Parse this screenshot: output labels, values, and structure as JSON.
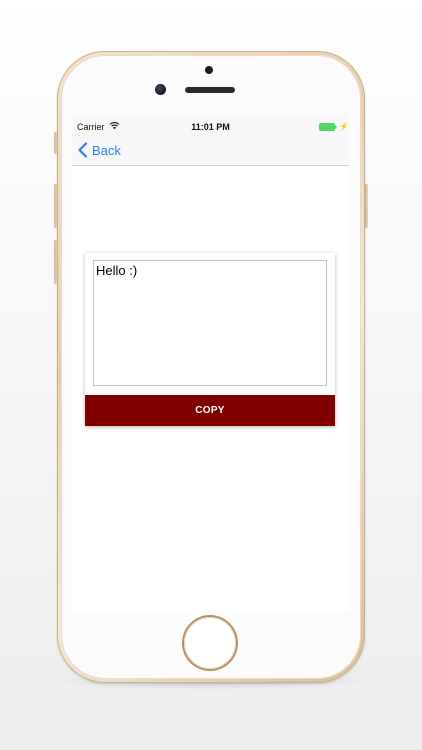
{
  "status_bar": {
    "carrier": "Carrier",
    "time": "11:01 PM",
    "wifi_icon": "wifi-icon",
    "battery_icon": "battery-charging-icon",
    "battery_color": "#4cd964"
  },
  "nav": {
    "back_label": "Back",
    "back_icon": "chevron-left-icon",
    "tint_color": "#2f7cf6"
  },
  "editor": {
    "text_value": "Hello :)",
    "copy_label": "COPY",
    "copy_button_color": "#800000"
  }
}
